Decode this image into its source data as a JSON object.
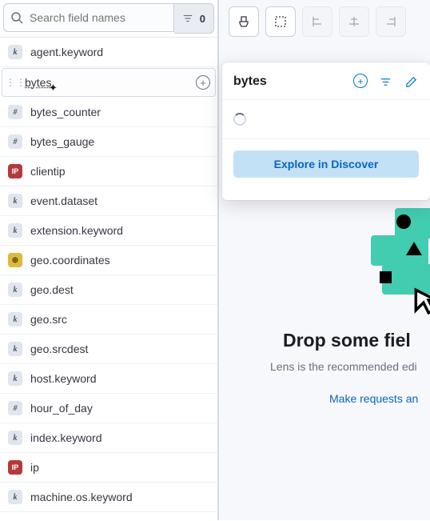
{
  "search": {
    "placeholder": "Search field names",
    "filter_count": "0"
  },
  "fields": [
    {
      "type": "k",
      "name": "agent.keyword"
    },
    {
      "type": "num",
      "name": "bytes",
      "hovered": true
    },
    {
      "type": "num",
      "name": "bytes_counter"
    },
    {
      "type": "num",
      "name": "bytes_gauge"
    },
    {
      "type": "ip",
      "name": "clientip"
    },
    {
      "type": "k",
      "name": "event.dataset"
    },
    {
      "type": "k",
      "name": "extension.keyword"
    },
    {
      "type": "geo",
      "name": "geo.coordinates"
    },
    {
      "type": "k",
      "name": "geo.dest"
    },
    {
      "type": "k",
      "name": "geo.src"
    },
    {
      "type": "k",
      "name": "geo.srcdest"
    },
    {
      "type": "k",
      "name": "host.keyword"
    },
    {
      "type": "num",
      "name": "hour_of_day"
    },
    {
      "type": "k",
      "name": "index.keyword"
    },
    {
      "type": "ip",
      "name": "ip"
    },
    {
      "type": "k",
      "name": "machine.os.keyword"
    }
  ],
  "flyout": {
    "title": "bytes",
    "explore_label": "Explore in Discover"
  },
  "dropzone": {
    "title": "Drop some fiel",
    "subtitle": "Lens is the recommended edi",
    "link": "Make requests an"
  },
  "type_glyphs": {
    "k": "k",
    "num": "#",
    "ip": "IP",
    "geo": "⊕"
  }
}
